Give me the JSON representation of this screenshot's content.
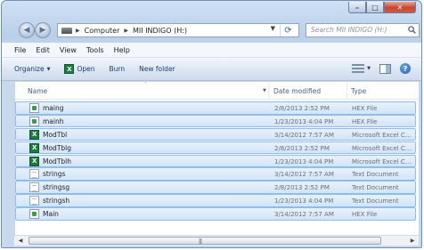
{
  "address": {
    "crumbs": [
      "Computer",
      "MII INDIGO (H:)"
    ],
    "search_placeholder": "Search MII INDIGO (H:)"
  },
  "menubar": [
    "File",
    "Edit",
    "View",
    "Tools",
    "Help"
  ],
  "commands": {
    "organize": "Organize",
    "open": "Open",
    "burn": "Burn",
    "new_folder": "New folder"
  },
  "columns": {
    "name": "Name",
    "date": "Date modified",
    "type": "Type"
  },
  "files": [
    {
      "name": "maing",
      "date": "2/8/2013 2:52 PM",
      "type": "HEX File",
      "icon": "hex"
    },
    {
      "name": "mainh",
      "date": "1/23/2013 4:04 PM",
      "type": "HEX File",
      "icon": "hex"
    },
    {
      "name": "ModTbl",
      "date": "3/14/2012 7:57 AM",
      "type": "Microsoft Excel C...",
      "icon": "excel"
    },
    {
      "name": "ModTblg",
      "date": "2/8/2013 2:52 PM",
      "type": "Microsoft Excel C...",
      "icon": "excel"
    },
    {
      "name": "ModTblh",
      "date": "1/23/2013 4:04 PM",
      "type": "Microsoft Excel C...",
      "icon": "excel"
    },
    {
      "name": "strings",
      "date": "3/14/2012 7:57 AM",
      "type": "Text Document",
      "icon": "text"
    },
    {
      "name": "stringsg",
      "date": "2/8/2013 2:52 PM",
      "type": "Text Document",
      "icon": "text"
    },
    {
      "name": "stringsh",
      "date": "1/23/2013 4:04 PM",
      "type": "Text Document",
      "icon": "text"
    },
    {
      "name": "Main",
      "date": "3/14/2012 7:57 AM",
      "type": "HEX File",
      "icon": "hex"
    }
  ]
}
